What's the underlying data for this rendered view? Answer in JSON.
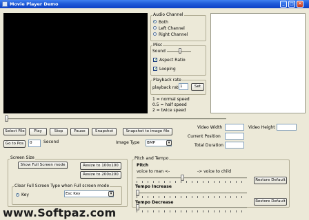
{
  "window": {
    "title": "Movie Player Demo",
    "minimize_label": "_",
    "maximize_label": "□",
    "close_label": "✕"
  },
  "audio_channel": {
    "title": "Audio Channel",
    "options": [
      "Both",
      "Left Channel",
      "Right Channel"
    ],
    "selected": "Both"
  },
  "misc": {
    "title": "Misc",
    "sound_label": "Sound",
    "aspect_ratio_label": "Aspect Ratio",
    "aspect_ratio_checked": true,
    "looping_label": "Looping",
    "looping_checked": true
  },
  "playback_rate": {
    "title": "Playback rate",
    "label": "playback rate",
    "value": "1",
    "set_label": "Set",
    "help": [
      "1 = normal speed",
      "0.5 = half speed",
      "2 = twice speed"
    ]
  },
  "controls": {
    "select_file": "Select File",
    "play": "Play",
    "stop": "Stop",
    "pause": "Pause",
    "snapshot": "Snapshot",
    "snapshot_to_file": "Snapshot to image file",
    "go_to_pos": "Go to Pos",
    "pos_value": "0",
    "second_label": "Second",
    "image_type_label": "Image Type",
    "image_type_value": "BMP"
  },
  "info": {
    "video_width_label": "Video Width",
    "video_height_label": "Video Height",
    "current_position_label": "Current Position",
    "total_duration_label": "Total Duration"
  },
  "screen_size": {
    "title": "Screen Size",
    "full_screen_mode": "Show Full Screen mode",
    "resize_100": "Resize to 100x100",
    "resize_200": "Resize to 200x200",
    "clear_label": "Clear Full Screen Type when Full screen mode",
    "key_label": "Key",
    "key_value": "Esc Key"
  },
  "pitch_tempo": {
    "title": "Pitch and Tempo",
    "pitch_label": "Pitch",
    "pitch_left": "voice to man <-",
    "pitch_right": "-> voice to child",
    "restore_label": "Restore Default",
    "tempo_increase_label": "Tempo Increase",
    "tempo_decrease_label": "Tempo Decrease"
  },
  "watermark": "www.Softpaz.com"
}
